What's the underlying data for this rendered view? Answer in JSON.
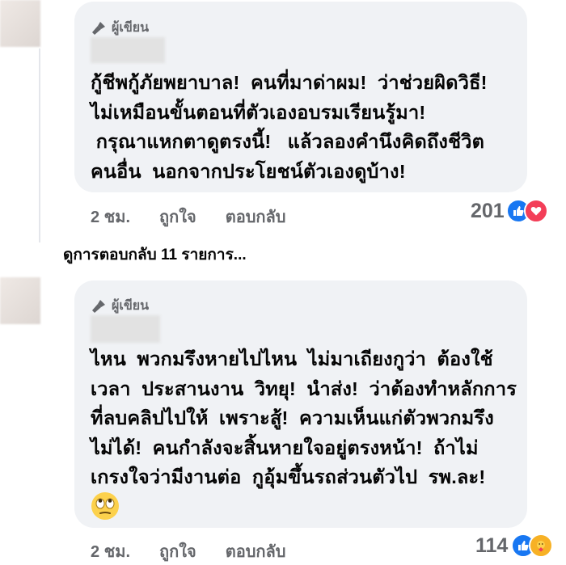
{
  "comments": [
    {
      "author_badge": "ผู้เขียน",
      "text": "กู้ชีพกู้ภัยพยาบาล!  คนที่มาด่าผม!  ว่าช่วยผิดวิธี!\nไม่เหมือนขั้นตอนที่ตัวเองอบรมเรียนรู้มา!\n กรุณาแหกตาดูตรงนี้!   แล้วลองคำนึงคิดถึงชีวิต\nคนอื่น  นอกจากประโยชน์ตัวเองดูบ้าง!",
      "time": "2 ชม.",
      "like_label": "ถูกใจ",
      "reply_label": "ตอบกลับ",
      "reaction_count": "201",
      "reaction_icons": [
        "like-icon",
        "love-icon"
      ]
    },
    {
      "author_badge": "ผู้เขียน",
      "text": "ไหน  พวกมรึงหายไปไหน  ไม่มาเถียงกูว่า  ต้องใช้\nเวลา  ประสานงาน  วิทยุ!  นำส่ง!  ว่าต้องทำหลักการ\nที่ลบคลิปไปให้  เพราะสู้!  ความเห็นแก่ตัวพวกมรึง\nไม่ได้!  คนกำลังจะสิ้นหายใจอยู่ตรงหน้า!  ถ้าไม่\nเกรงใจว่ามีงานต่อ  กูอุ้มขึ้นรถส่วนตัวไป  รพ.ละ!",
      "emoji": "eye-roll-emoji",
      "time": "2 ชม.",
      "like_label": "ถูกใจ",
      "reply_label": "ตอบกลับ",
      "reaction_count": "114",
      "reaction_icons": [
        "like-icon",
        "care-icon"
      ]
    }
  ],
  "view_replies": {
    "prefix": "ดูการตอบกลับ",
    "count": "11",
    "suffix": "รายการ..."
  },
  "colors": {
    "bubble": "#f0f2f5",
    "secondary_text": "#65676b",
    "like_blue": "#1877f2",
    "love_red": "#f33e58",
    "care_yellow": "#f7b125"
  }
}
